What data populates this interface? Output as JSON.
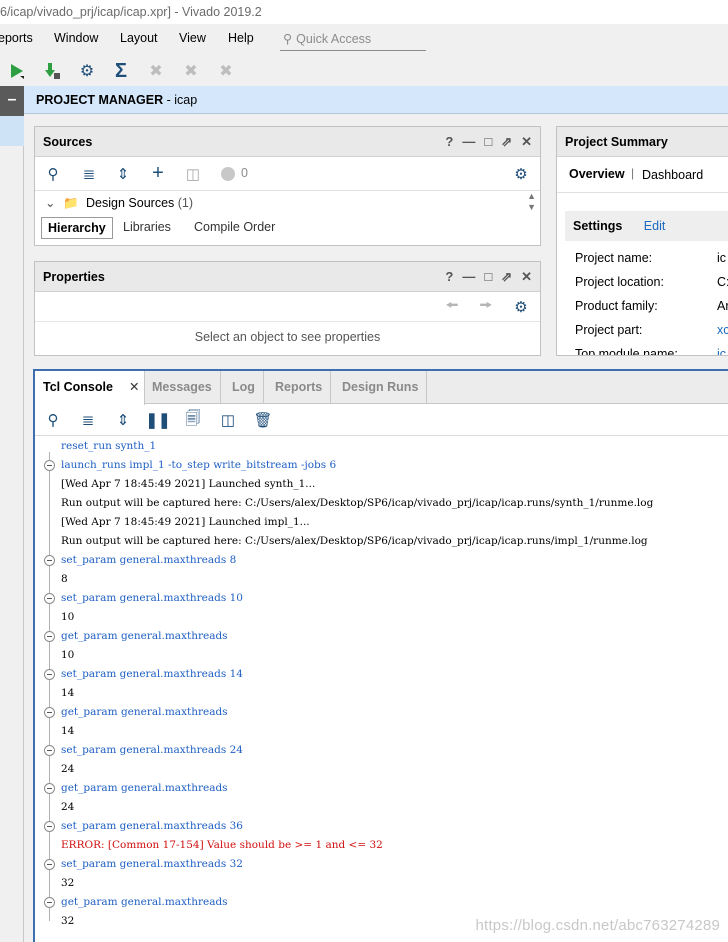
{
  "window": {
    "title": "6/icap/vivado_prj/icap/icap.xpr] - Vivado 2019.2"
  },
  "menu": [
    "eports",
    "Window",
    "Layout",
    "View",
    "Help"
  ],
  "quick_access": {
    "placeholder": "Quick Access"
  },
  "project_manager": {
    "label": "PROJECT MANAGER",
    "project": "- icap"
  },
  "sources": {
    "title": "Sources",
    "count_badge": "0",
    "tree_item": "Design Sources",
    "tree_item_count": "(1)",
    "tabs": [
      "Hierarchy",
      "Libraries",
      "Compile Order"
    ]
  },
  "properties": {
    "title": "Properties",
    "empty_text": "Select an object to see properties"
  },
  "summary": {
    "title": "Project Summary",
    "tabs": [
      "Overview",
      "Dashboard"
    ],
    "settings_label": "Settings",
    "edit_label": "Edit",
    "rows": [
      {
        "label": "Project name:",
        "value": "ic"
      },
      {
        "label": "Project location:",
        "value": "C:"
      },
      {
        "label": "Product family:",
        "value": "Ar"
      },
      {
        "label": "Project part:",
        "value": "xc"
      },
      {
        "label": "Top module name:",
        "value": "ic"
      }
    ]
  },
  "console": {
    "tabs": [
      "Tcl Console",
      "Messages",
      "Log",
      "Reports",
      "Design Runs"
    ],
    "lines": [
      {
        "kind": "cmd",
        "text": "reset_run synth_1"
      },
      {
        "kind": "cmd",
        "text": "launch_runs impl_1 -to_step write_bitstream -jobs 6"
      },
      {
        "kind": "out",
        "text": "[Wed Apr  7 18:45:49 2021] Launched synth_1..."
      },
      {
        "kind": "out",
        "text": "Run output will be captured here: C:/Users/alex/Desktop/SP6/icap/vivado_prj/icap/icap.runs/synth_1/runme.log"
      },
      {
        "kind": "out",
        "text": "[Wed Apr  7 18:45:49 2021] Launched impl_1..."
      },
      {
        "kind": "out",
        "text": "Run output will be captured here: C:/Users/alex/Desktop/SP6/icap/vivado_prj/icap/icap.runs/impl_1/runme.log"
      },
      {
        "kind": "cmd",
        "text": "set_param general.maxthreads 8"
      },
      {
        "kind": "out",
        "text": "8"
      },
      {
        "kind": "cmd",
        "text": "set_param general.maxthreads 10"
      },
      {
        "kind": "out",
        "text": "10"
      },
      {
        "kind": "cmd",
        "text": "get_param general.maxthreads"
      },
      {
        "kind": "out",
        "text": "10"
      },
      {
        "kind": "cmd",
        "text": "set_param general.maxthreads 14"
      },
      {
        "kind": "out",
        "text": "14"
      },
      {
        "kind": "cmd",
        "text": "get_param general.maxthreads"
      },
      {
        "kind": "out",
        "text": "14"
      },
      {
        "kind": "cmd",
        "text": "set_param general.maxthreads 24"
      },
      {
        "kind": "out",
        "text": "24"
      },
      {
        "kind": "cmd",
        "text": "get_param general.maxthreads"
      },
      {
        "kind": "out",
        "text": "24"
      },
      {
        "kind": "cmd",
        "text": "set_param general.maxthreads 36"
      },
      {
        "kind": "err",
        "text": "ERROR: [Common 17-154] Value should be >= 1 and <= 32"
      },
      {
        "kind": "cmd",
        "text": "set_param general.maxthreads 32"
      },
      {
        "kind": "out",
        "text": "32"
      },
      {
        "kind": "cmd",
        "text": "get_param general.maxthreads"
      },
      {
        "kind": "out",
        "text": "32"
      }
    ]
  },
  "watermark": "https://blog.csdn.net/abc763274289"
}
